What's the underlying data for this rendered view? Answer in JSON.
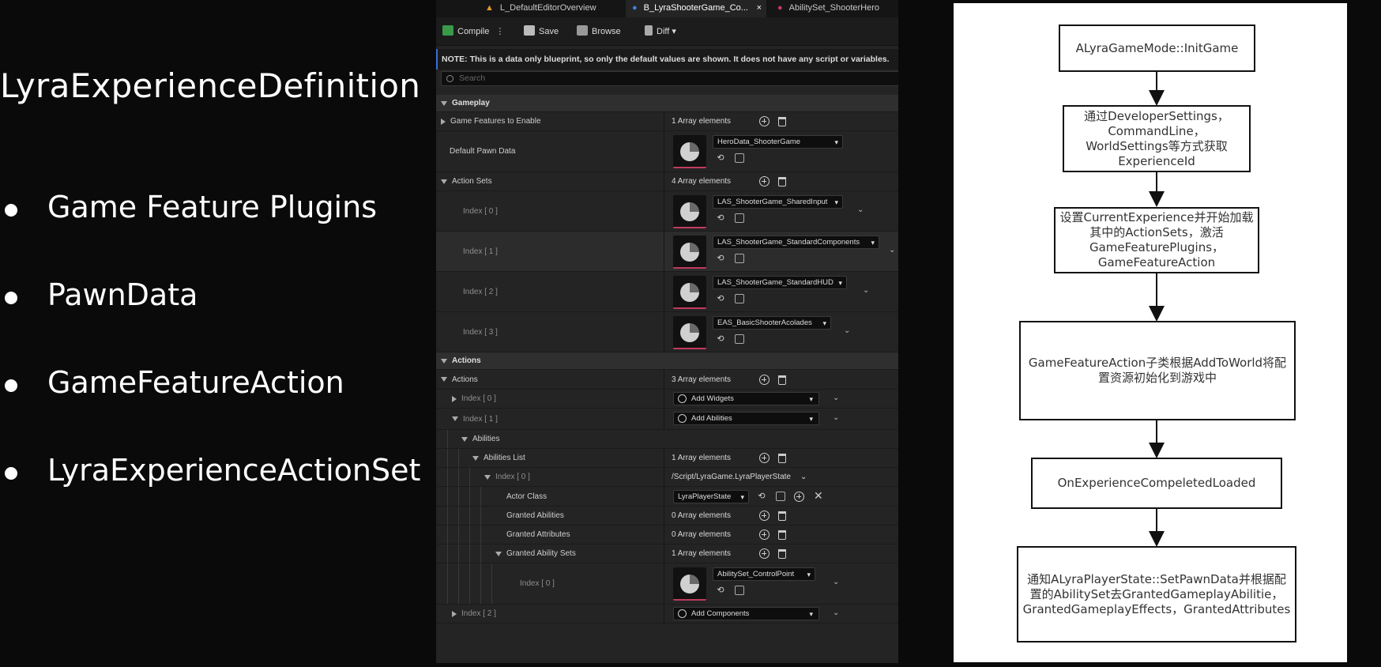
{
  "slide": {
    "title": "LyraExperienceDefinition",
    "bullets": [
      {
        "label": "Game Feature Plugins"
      },
      {
        "label": "PawnData"
      },
      {
        "label": "GameFeatureAction"
      },
      {
        "label": "LyraExperienceActionSet"
      }
    ]
  },
  "editor": {
    "tabs": [
      "L_DefaultEditorOverview",
      "B_LyraShooterGame_Co...",
      "AbilitySet_ShooterHero"
    ],
    "tab_close": "×",
    "toolbar": {
      "compile": "Compile",
      "save": "Save",
      "browse": "Browse",
      "diff": "Diff"
    },
    "note": "NOTE: This is a data only blueprint, so only the default values are shown.  It does not have any script or variables.",
    "search_placeholder": "Search",
    "rows": {
      "gameplay": "Gameplay",
      "game_features": "Game Features to Enable",
      "game_features_val": "1 Array elements",
      "default_pawn": "Default Pawn Data",
      "default_pawn_val": "HeroData_ShooterGame",
      "action_sets": "Action Sets",
      "action_sets_val": "4 Array elements",
      "as_index": [
        {
          "label": "Index [ 0 ]",
          "value": "LAS_ShooterGame_SharedInput"
        },
        {
          "label": "Index [ 1 ]",
          "value": "LAS_ShooterGame_StandardComponents"
        },
        {
          "label": "Index [ 2 ]",
          "value": "LAS_ShooterGame_StandardHUD"
        },
        {
          "label": "Index [ 3 ]",
          "value": "EAS_BasicShooterAcolades"
        }
      ],
      "actions_cat": "Actions",
      "actions": "Actions",
      "actions_val": "3 Array elements",
      "act0": "Index [ 0 ]",
      "act0_val": "Add Widgets",
      "act1": "Index [ 1 ]",
      "act1_val": "Add Abilities",
      "abilities": "Abilities",
      "abilities_list": "Abilities List",
      "abilities_list_val": "1 Array elements",
      "al_index": "Index [ 0 ]",
      "al_index_val": "/Script/LyraGame.LyraPlayerState",
      "actor_class": "Actor Class",
      "actor_class_val": "LyraPlayerState",
      "granted_abilities": "Granted Abilities",
      "granted_abilities_val": "0 Array elements",
      "granted_attributes": "Granted Attributes",
      "granted_attributes_val": "0 Array elements",
      "granted_sets": "Granted Ability Sets",
      "granted_sets_val": "1 Array elements",
      "gs_index": "Index [ 0 ]",
      "gs_index_val": "AbilitySet_ControlPoint",
      "act2": "Index [ 2 ]",
      "act2_val": "Add Components"
    }
  },
  "flowchart": {
    "nodes": [
      "ALyraGameMode::InitGame",
      "通过DeveloperSettings，CommandLine，WorldSettings等方式获取ExperienceId",
      "设置CurrentExperience并开始加载其中的ActionSets，激活GameFeaturePlugins，GameFeatureAction",
      "GameFeatureAction子类根据AddToWorld将配置资源初始化到游戏中",
      "OnExperienceCompeletedLoaded",
      "通知ALyraPlayerState::SetPawnData并根据配置的AbilitySet去GrantedGameplayAbilitie，GrantedGameplayEffects，GrantedAttributes"
    ]
  }
}
